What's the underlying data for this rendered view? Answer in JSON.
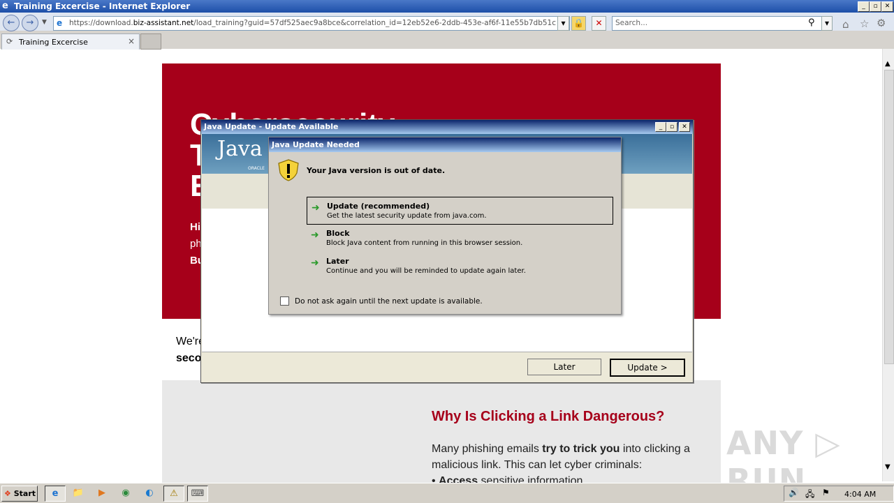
{
  "browser": {
    "title": "Training Excercise - Internet Explorer",
    "url_prefix": "https://download.",
    "url_domain": "biz-assistant.net",
    "url_path": "/load_training?guid=57df525aec9a8bce&correlation_id=12eb52e6-2ddb-453e-af6f-11e55b7db51c",
    "search_placeholder": "Search...",
    "tab_label": "Training Excercise",
    "tab_close": "×",
    "min": "_",
    "max": "▫",
    "close": "✕"
  },
  "page": {
    "hero_line1": "Cybersecurity",
    "hero_line2": "T",
    "hero_line3": "E",
    "hero_hi": "Hi",
    "hero_ph": "ph",
    "hero_bu": "Bu",
    "intro_text": "We're",
    "intro_bold": "seco",
    "why_heading": "Why Is Clicking a Link Dangerous?",
    "para_start": "Many phishing emails ",
    "para_bold": "try to trick you",
    "para_end": " into clicking a malicious link. This can let cyber criminals:",
    "bullet_bold": "Access",
    "bullet_rest": " sensitive information",
    "watermark": "ANY ▷ RUN"
  },
  "java_window": {
    "title": "Java Update - Update Available",
    "logo": "Java",
    "oracle": "ORACLE",
    "later_button": "Later",
    "update_button": "Update >"
  },
  "dialog": {
    "title": "Java Update Needed",
    "message": "Your Java version is out of date.",
    "options": [
      {
        "heading": "Update (recommended)",
        "desc": "Get the latest security update from java.com.",
        "selected": true
      },
      {
        "heading": "Block",
        "desc": "Block Java content from running in this browser session.",
        "selected": false
      },
      {
        "heading": "Later",
        "desc": "Continue and you will be reminded to update again later.",
        "selected": false
      }
    ],
    "checkbox_label": "Do not ask again until the next update is available.",
    "checkbox_checked": false
  },
  "taskbar": {
    "start_label": "Start",
    "clock": "4:04 AM"
  }
}
